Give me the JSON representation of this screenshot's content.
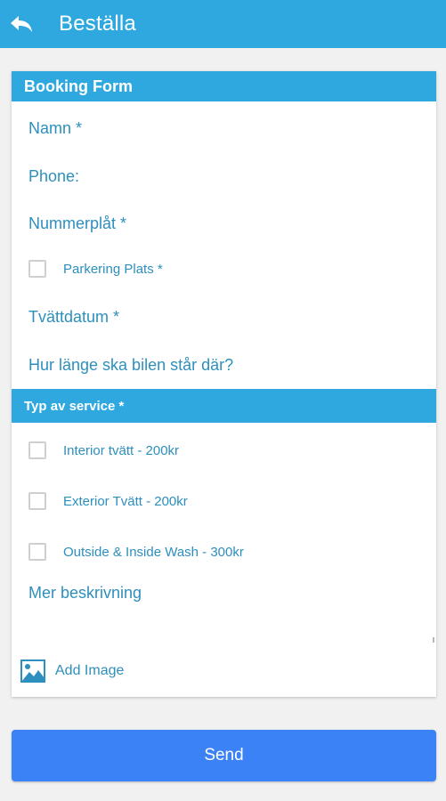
{
  "appbar": {
    "title": "Beställa",
    "back_icon": "reply-arrow-icon",
    "color": "#2ea8de"
  },
  "form": {
    "header": "Booking Form",
    "fields": {
      "name": "Namn *",
      "phone": "Phone:",
      "plate": "Nummerplåt *",
      "parking": "Parkering Plats *",
      "wash_date": "Tvättdatum *",
      "duration": "Hur länge ska bilen står där?"
    },
    "service_header": "Typ av service *",
    "services": [
      {
        "label": "Interior tvätt - 200kr",
        "checked": false
      },
      {
        "label": "Exterior Tvätt - 200kr",
        "checked": false
      },
      {
        "label": "Outside & Inside Wash - 300kr",
        "checked": false
      }
    ],
    "description_label": "Mer beskrivning",
    "add_image_label": "Add Image",
    "add_image_icon": "image-icon"
  },
  "send_label": "Send",
  "send_color": "#3b82f6"
}
